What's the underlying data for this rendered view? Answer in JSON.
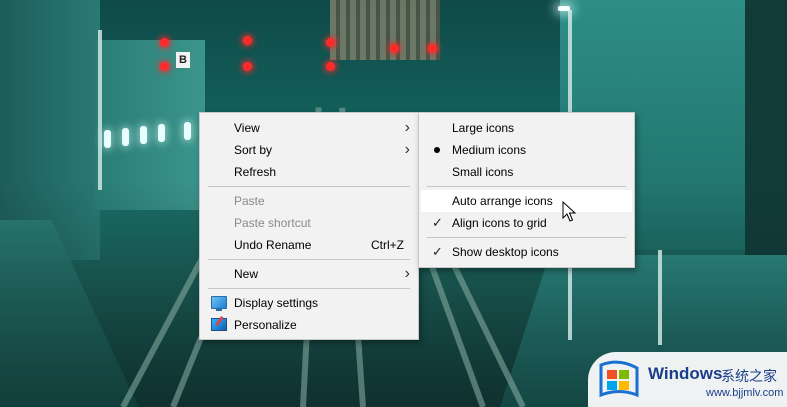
{
  "context_menu": {
    "items": [
      {
        "label": "View",
        "submenu": true
      },
      {
        "label": "Sort by",
        "submenu": true
      },
      {
        "label": "Refresh"
      },
      {
        "label": "Paste",
        "disabled": true
      },
      {
        "label": "Paste shortcut",
        "disabled": true
      },
      {
        "label": "Undo Rename",
        "shortcut": "Ctrl+Z"
      },
      {
        "label": "New",
        "submenu": true
      },
      {
        "label": "Display settings",
        "icon": "display-icon"
      },
      {
        "label": "Personalize",
        "icon": "personalize-icon"
      }
    ]
  },
  "view_submenu": {
    "items": [
      {
        "label": "Large icons"
      },
      {
        "label": "Medium icons",
        "selected": true
      },
      {
        "label": "Small icons"
      },
      {
        "label": "Auto arrange icons",
        "hovered": true
      },
      {
        "label": "Align icons to grid",
        "checked": true
      },
      {
        "label": "Show desktop icons",
        "checked": true
      }
    ]
  },
  "wallpaper": {
    "sign_text": "B"
  },
  "watermark": {
    "title": "Windows",
    "subtitle_cn": "系统之家",
    "url": "www.bjjmlv.com"
  },
  "colors": {
    "menu_bg": "#f2f2f2",
    "menu_hover": "#ffffff",
    "disabled_text": "#8a8a8a",
    "watermark_blue": "#1b3e8a"
  }
}
